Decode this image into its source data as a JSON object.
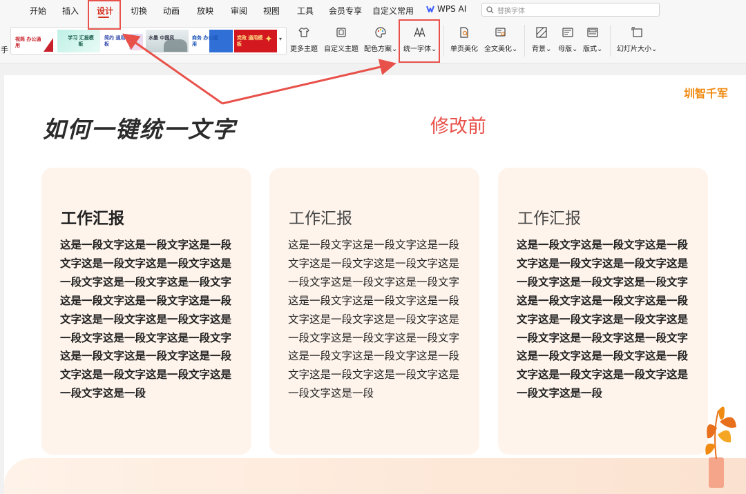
{
  "menu_tabs": [
    {
      "label": "开始"
    },
    {
      "label": "插入"
    },
    {
      "label": "设计"
    },
    {
      "label": "切换"
    },
    {
      "label": "动画"
    },
    {
      "label": "放映"
    },
    {
      "label": "审阅"
    },
    {
      "label": "视图"
    },
    {
      "label": "工具"
    },
    {
      "label": "会员专享"
    },
    {
      "label": "自定义常用"
    }
  ],
  "active_tab": "设计",
  "wps_ai": {
    "label": "WPS AI"
  },
  "search": {
    "placeholder": "替换字体"
  },
  "ribbon": {
    "left_char": "手",
    "themes": [
      {
        "label": "视简 办公通用"
      },
      {
        "label": "学习 汇报模板"
      },
      {
        "label": "简约 通用模板"
      },
      {
        "label": "水墨 中国风"
      },
      {
        "label": "商务 办公通用"
      },
      {
        "label": "党政 通用模板"
      }
    ],
    "tools": {
      "more_themes": "更多主题",
      "custom_theme": "自定义主题",
      "color_scheme": "配色方案",
      "unify_font": "统一字体",
      "page_beautify": "单页美化",
      "full_beautify": "全文美化",
      "background": "背景",
      "master": "母版",
      "layout": "版式",
      "slide_size": "幻灯片大小"
    }
  },
  "slide": {
    "brand": "圳智千军",
    "title": "如何一键统一文字",
    "before_label": "修改前",
    "cards": [
      {
        "title": "工作汇报",
        "body": "这是一段文字这是一段文字这是一段文字这是一段文字这是一段文字这是一段文字这是一段文字这是一段文字这是一段文字这是一段文字这是一段文字这是一段文字这是一段文字这是一段文字这是一段文字这是一段文字这是一段文字这是一段文字这是一段文字这是一段文字这是一段文字这是一段文字这是一段"
      },
      {
        "title": "工作汇报",
        "body": "这是一段文字这是一段文字这是一段文字这是一段文字这是一段文字这是一段文字这是一段文字这是一段文字这是一段文字这是一段文字这是一段文字这是一段文字这是一段文字这是一段文字这是一段文字这是一段文字这是一段文字这是一段文字这是一段文字这是一段文字这是一段文字这是一段文字这是一段"
      },
      {
        "title": "工作汇报",
        "body": "这是一段文字这是一段文字这是一段文字这是一段文字这是一段文字这是一段文字这是一段文字这是一段文字这是一段文字这是一段文字这是一段文字这是一段文字这是一段文字这是一段文字这是一段文字这是一段文字这是一段文字这是一段文字这是一段文字这是一段文字这是一段文字这是一段文字这是一段"
      }
    ]
  },
  "colors": {
    "accent_red": "#d6301f",
    "annotation_red": "#e8514a",
    "brand_orange": "#f08a10",
    "card_bg": "#fef4ec"
  }
}
